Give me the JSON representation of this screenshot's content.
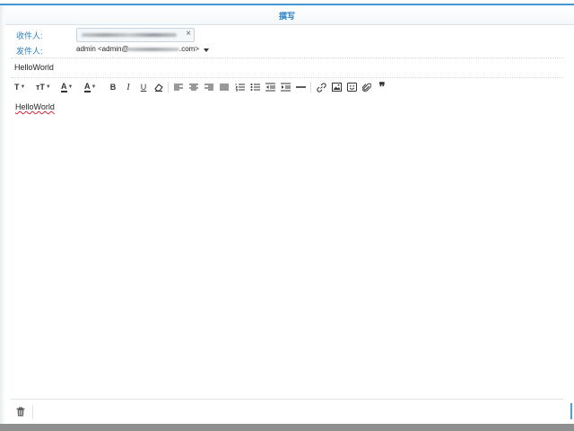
{
  "window": {
    "title": "撰写"
  },
  "compose": {
    "to_label": "收件人:",
    "from_label": "发件人:",
    "from_prefix": "admin <admin@",
    "from_suffix": ".com>",
    "remove_symbol": "×",
    "subject": "HelloWorld",
    "body": "HelloWorld"
  },
  "toolbar": {
    "font_label": "T",
    "size_label": "тT",
    "color_label": "A",
    "bg_color_label": "A",
    "bold_label": "B",
    "italic_label": "I",
    "underline_label": "U",
    "quote_label": "❞"
  },
  "colors": {
    "accent": "#2b7fc1",
    "accent_bar": "#3f97d6",
    "text": "#333333"
  }
}
